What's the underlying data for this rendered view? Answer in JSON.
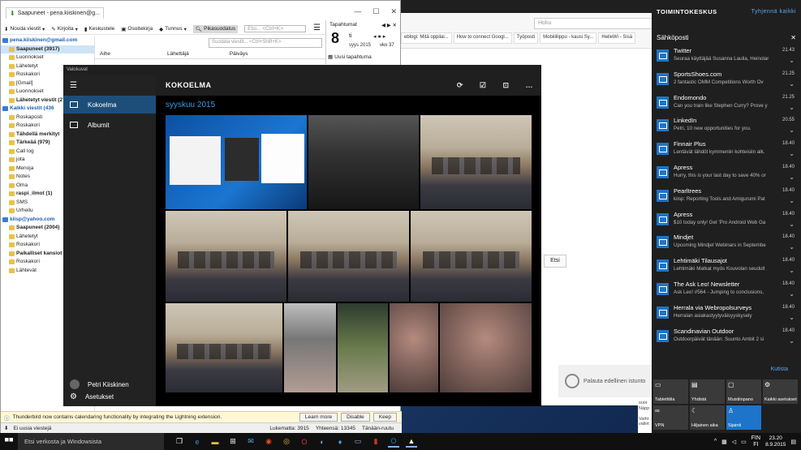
{
  "browser": {
    "search_placeholder": "Hoku",
    "tabs": [
      "eblogi: Mitä oppilai...",
      "How to connect Googl...",
      "Työposti",
      "Mobiililippu - kausi Sy...",
      "HelleWi - Sisä"
    ],
    "etsi_button": "Etsi",
    "restore_text": "Palauta edellinen istunto"
  },
  "thunderbird": {
    "tab_title": "Saapuneet - pena.kiiskinen@g...",
    "toolbar": [
      "Nouda viestit",
      "Kirjoita",
      "Keskustele",
      "Osoitekirja",
      "Tunnus",
      "Pikasuodatus"
    ],
    "filter_placeholder": "Suodata viestit... <Ctrl+Shift+K>",
    "search_placeholder": "Etsi... <Ctrl+K>",
    "columns": [
      "Aihe",
      "Lähettäjä",
      "Päiväys"
    ],
    "folders": [
      {
        "label": "pena.kiiskinen@gmail.com",
        "type": "account"
      },
      {
        "label": "Saapuneet (3917)",
        "type": "bold-sel"
      },
      {
        "label": "Luonnokset",
        "type": "normal"
      },
      {
        "label": "Lähetetyt",
        "type": "normal"
      },
      {
        "label": "Roskakori",
        "type": "normal"
      },
      {
        "label": "[Gmail]",
        "type": "normal"
      },
      {
        "label": "Luonnokset",
        "type": "normal"
      },
      {
        "label": "Lähetetyt viestit (27)",
        "type": "bold"
      },
      {
        "label": "Kaikki viestit (436",
        "type": "account"
      },
      {
        "label": "Roskaposti",
        "type": "normal"
      },
      {
        "label": "Roskakori",
        "type": "normal"
      },
      {
        "label": "Tähdellä merkityt",
        "type": "bold"
      },
      {
        "label": "Tärkeää (979)",
        "type": "bold"
      },
      {
        "label": "Call log",
        "type": "normal"
      },
      {
        "label": "jota",
        "type": "normal"
      },
      {
        "label": "Menoja",
        "type": "normal"
      },
      {
        "label": "Notes",
        "type": "normal"
      },
      {
        "label": "Oma",
        "type": "normal"
      },
      {
        "label": "raspi_ilmot (1)",
        "type": "bold"
      },
      {
        "label": "SMS",
        "type": "normal"
      },
      {
        "label": "Urheilu",
        "type": "normal"
      },
      {
        "label": "kiisp@yahoo.com",
        "type": "account"
      },
      {
        "label": "Saapuneet (2004)",
        "type": "bold"
      },
      {
        "label": "Lähetetyt",
        "type": "normal"
      },
      {
        "label": "Roskakori",
        "type": "normal"
      },
      {
        "label": "Paikalliset kansiot",
        "type": "bold"
      },
      {
        "label": "Roskakori",
        "type": "normal"
      },
      {
        "label": "Lähtevät",
        "type": "normal"
      }
    ],
    "notification": {
      "text": "Thunderbird now contains calendaring functionality by integrating the Lightning extension.",
      "learn_more": "Learn more",
      "disable": "Disable",
      "keep": "Keep"
    },
    "status": {
      "left": "Ei uusia viestejä",
      "unread": "Lukematta: 3915",
      "total": "Yhteensä: 13345",
      "today": "Tänään-ruutu"
    }
  },
  "calendar": {
    "header": "Tapahtumat",
    "day_number": "8",
    "day_name": "ti",
    "month": "syys 2015",
    "week": "vko 37",
    "new_event": "Uusi tapahtuma"
  },
  "photos": {
    "window_title": "Valokuvat",
    "nav": [
      {
        "label": "Kokoelma",
        "active": true
      },
      {
        "label": "Albumit",
        "active": false
      }
    ],
    "header": "KOKOELMA",
    "date_heading": "syyskuu 2015",
    "user_name": "Petri Kiiskinen",
    "settings_label": "Asetukset"
  },
  "action_center": {
    "title": "TOIMINTOKESKUS",
    "clear_all": "Tyhjennä kaikki",
    "section": "Sähköposti",
    "items": [
      {
        "title": "Twitter",
        "snippet": "Seuraa käyttäjää Susanna Laulia, Heinolar",
        "time": "21.43"
      },
      {
        "title": "SportsShoes.com",
        "snippet": "2 fantastic OMM Competitions Worth Ov",
        "time": "21.25"
      },
      {
        "title": "Endomondo",
        "snippet": "Can you train like Stephen Curry? Prove y",
        "time": "21.25"
      },
      {
        "title": "LinkedIn",
        "snippet": "Petri, 10 new opportunities for you.",
        "time": "20.55"
      },
      {
        "title": "Finnair Plus",
        "snippet": "Lentävät lähdöt kymmeniin kohteisiin alk.",
        "time": "18.40"
      },
      {
        "title": "Apress",
        "snippet": "Hurry, this is your last day to save 40% or",
        "time": "18.40"
      },
      {
        "title": "Pearltrees",
        "snippet": "kiisp: Reporting Tools and Amigurumi Pat",
        "time": "18.40"
      },
      {
        "title": "Apress",
        "snippet": "$10 today only! Get 'Pro Android Web Ga",
        "time": "18.40"
      },
      {
        "title": "Mindjet",
        "snippet": "Upcoming Mindjet Webinars in Septembe",
        "time": "18.40"
      },
      {
        "title": "Lehtimäki Tilausajot",
        "snippet": "Lehtimäki Matkat myös Kouvolan seudult",
        "time": "18.40"
      },
      {
        "title": "The Ask Leo! Newsletter",
        "snippet": "Ask Leo! #564 - Jumping to conclusions,",
        "time": "18.40"
      },
      {
        "title": "Herrala via Webropolsurveys",
        "snippet": "Herralan asiakastyytyväisyyskysely",
        "time": "18.40"
      },
      {
        "title": "Scandinavian Outdoor",
        "snippet": "Outdoorpäivät tänään: Suunto Ambit 2 si",
        "time": "18.40"
      }
    ],
    "collapse": "Kutista",
    "tiles": [
      {
        "label": "Tablettitila",
        "icon": "▭",
        "on": false
      },
      {
        "label": "Yhdistä",
        "icon": "▤",
        "on": false
      },
      {
        "label": "Muistiinpano",
        "icon": "▢",
        "on": false
      },
      {
        "label": "Kaikki asetukset",
        "icon": "⚙",
        "on": false
      },
      {
        "label": "VPN",
        "icon": "∞",
        "on": false
      },
      {
        "label": "Hiljainen aika",
        "icon": "☾",
        "on": false
      },
      {
        "label": "Sijainti",
        "icon": "♙",
        "on": true
      }
    ]
  },
  "tooltip": {
    "lines": [
      "suor",
      "Näpp",
      "",
      "Vaiht",
      "valint"
    ]
  },
  "taskbar": {
    "search_placeholder": "Etsi verkosta ja Windowsista",
    "lang": "FIN",
    "lang_sub": "FI",
    "time": "23.20",
    "date": "8.9.2015"
  }
}
